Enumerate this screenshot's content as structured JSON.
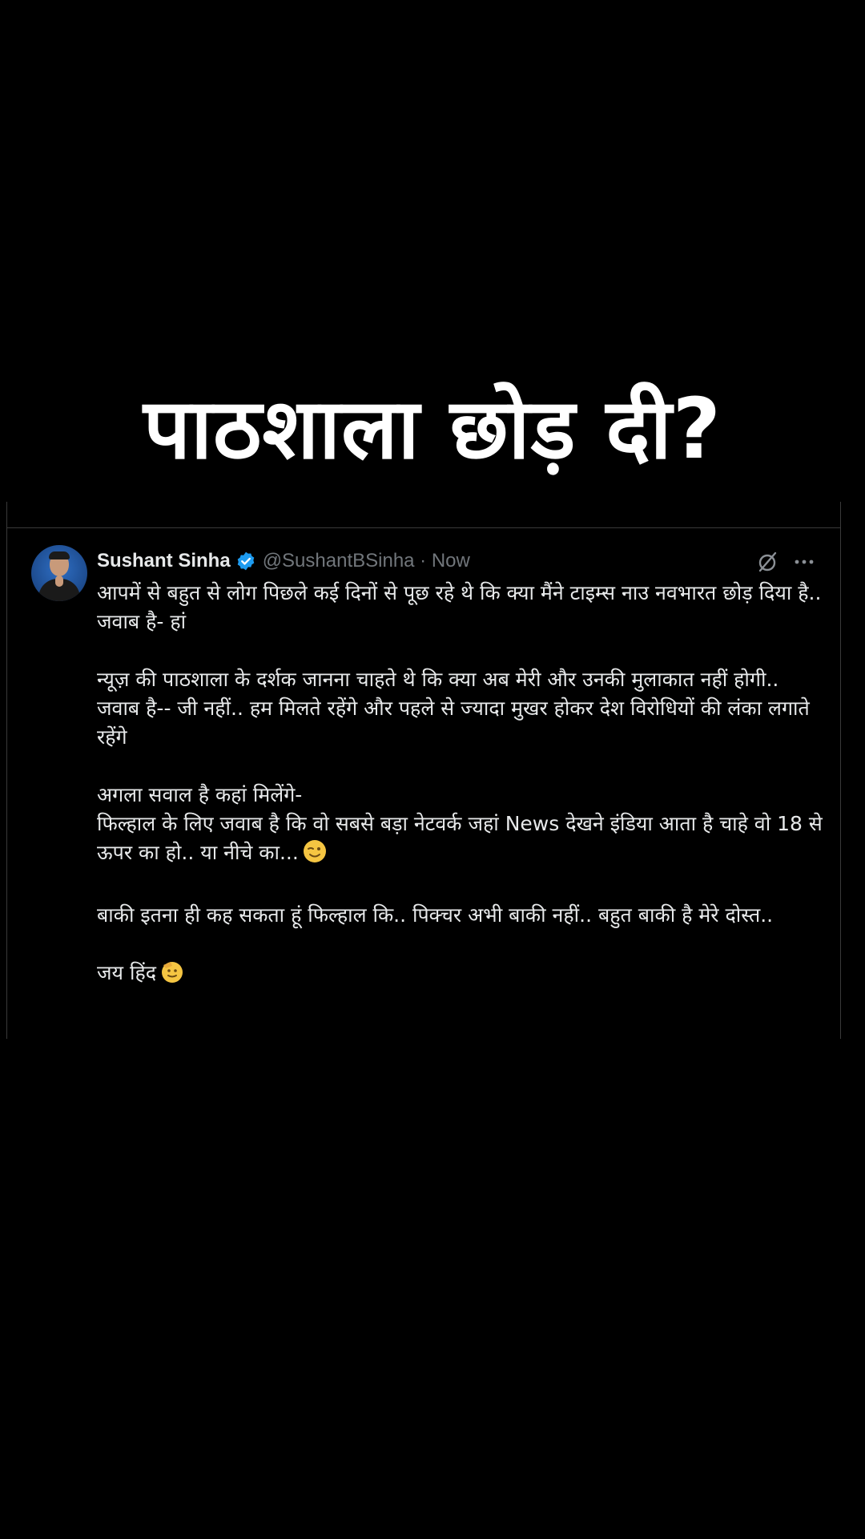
{
  "headline": "पाठशाला छोड़ दी?",
  "tweet": {
    "author_name": "Sushant Sinha",
    "handle_time": "@SushantBSinha · Now",
    "paragraphs": [
      [
        "आपमें से बहुत से लोग पिछले कई दिनों से पूछ रहे थे कि क्या मैंने टाइम्स नाउ नवभारत छोड़ दिया है..",
        "जवाब है- हां"
      ],
      [
        "न्यूज़ की पाठशाला के दर्शक जानना चाहते थे कि क्या अब मेरी और उनकी मुलाकात नहीं होगी..",
        "जवाब है-- जी नहीं.. हम मिलते रहेंगे और पहले से ज्यादा मुखर होकर देश विरोधियों की लंका लगाते रहेंगे"
      ],
      [
        "अगला सवाल है कहां मिलेंगे-",
        "फिल्हाल के लिए जवाब है कि वो सबसे बड़ा नेटवर्क जहां News देखने इंडिया आता है चाहे वो 18 से ऊपर का हो.. या नीचे का..."
      ],
      [
        "बाकी इतना ही कह सकता हूं फिल्हाल कि.. पिक्चर अभी बाकी नहीं.. बहुत बाकी है मेरे दोस्त.."
      ],
      [
        "जय हिंद"
      ]
    ]
  },
  "icons": {
    "verified": "verified-badge-icon",
    "grok": "grok-icon",
    "more": "more-options-icon",
    "wink": "winking-face-emoji",
    "salute": "saluting-face-emoji"
  },
  "colors": {
    "background": "#000000",
    "text": "#e7e9ea",
    "muted": "#71767b",
    "verified": "#1d9bf0",
    "emoji": "#f5c542"
  }
}
